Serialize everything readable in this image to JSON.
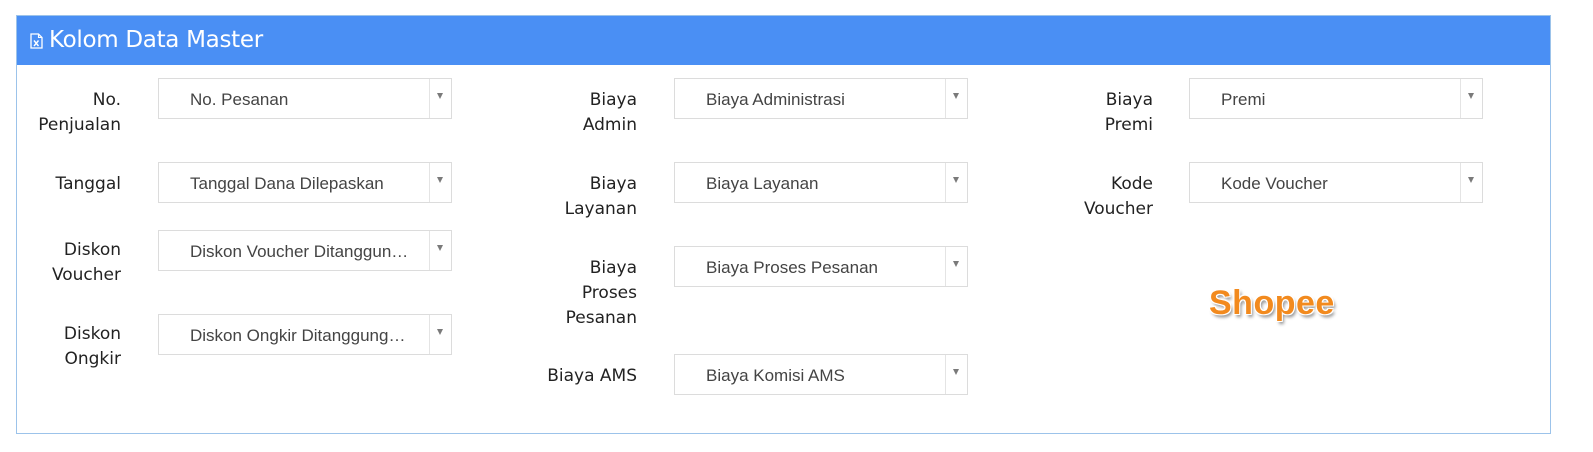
{
  "header": {
    "title": "Kolom Data Master",
    "icon": "excel-file-icon",
    "background": "#4a8ff4"
  },
  "fields": {
    "no_penjualan": {
      "label_line1": "No.",
      "label_line2": "Penjualan",
      "value": "No. Pesanan"
    },
    "tanggal": {
      "label_line1": "Tanggal",
      "value": "Tanggal Dana Dilepaskan"
    },
    "diskon_voucher": {
      "label_line1": "Diskon",
      "label_line2": "Voucher",
      "value": "Diskon Voucher Ditanggung Penjual"
    },
    "diskon_ongkir": {
      "label_line1": "Diskon",
      "label_line2": "Ongkir",
      "value": "Diskon Ongkir Ditanggung Penjual"
    },
    "biaya_admin": {
      "label_line1": "Biaya",
      "label_line2": "Admin",
      "value": "Biaya Administrasi"
    },
    "biaya_layanan": {
      "label_line1": "Biaya",
      "label_line2": "Layanan",
      "value": "Biaya Layanan"
    },
    "biaya_proses": {
      "label_line1": "Biaya",
      "label_line2": "Proses",
      "label_line3": "Pesanan",
      "value": "Biaya Proses Pesanan"
    },
    "biaya_ams": {
      "label_line1": "Biaya AMS",
      "value": "Biaya Komisi AMS"
    },
    "biaya_premi": {
      "label_line1": "Biaya",
      "label_line2": "Premi",
      "value": "Premi"
    },
    "kode_voucher": {
      "label_line1": "Kode",
      "label_line2": "Voucher",
      "value": "Kode Voucher"
    }
  },
  "brand": {
    "text": "Shopee",
    "color": "#f28a1e"
  }
}
